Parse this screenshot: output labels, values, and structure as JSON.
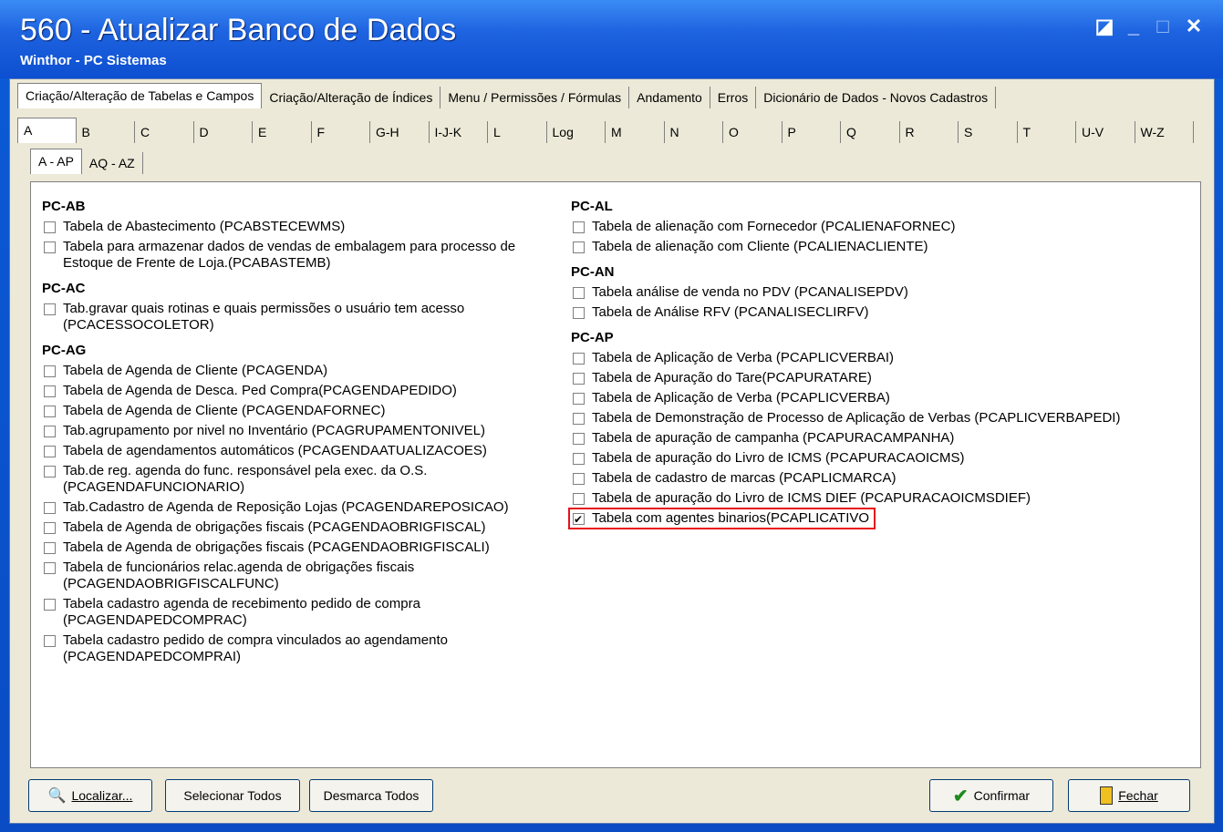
{
  "window": {
    "title": "560 - Atualizar Banco de Dados",
    "subtitle": "Winthor - PC Sistemas",
    "controls": [
      "◪",
      "_",
      "□",
      "✕"
    ]
  },
  "main_tabs": [
    "Criação/Alteração de Tabelas e Campos",
    "Criação/Alteração de Índices",
    "Menu / Permissões / Fórmulas",
    "Andamento",
    "Erros",
    "Dicionário de Dados - Novos Cadastros"
  ],
  "letter_tabs": [
    "A",
    "B",
    "C",
    "D",
    "E",
    "F",
    "G-H",
    "I-J-K",
    "L",
    "Log",
    "M",
    "N",
    "O",
    "P",
    "Q",
    "R",
    "S",
    "T",
    "U-V",
    "W-Z"
  ],
  "sub_tabs": [
    "A - AP",
    "AQ - AZ"
  ],
  "left_groups": [
    {
      "name": "PC-AB",
      "items": [
        {
          "text": "Tabela de Abastecimento (PCABSTECEWMS)",
          "checked": false
        },
        {
          "text": "Tabela para armazenar dados de vendas de embalagem para processo de",
          "text2": "Estoque de Frente de Loja.(PCABASTEMB)",
          "checked": false
        }
      ]
    },
    {
      "name": "PC-AC",
      "items": [
        {
          "text": "Tab.gravar quais rotinas e quais permissões o usuário tem acesso",
          "text2": "(PCACESSOCOLETOR)",
          "checked": false
        }
      ]
    },
    {
      "name": "PC-AG",
      "items": [
        {
          "text": "Tabela  de Agenda de Cliente (PCAGENDA)",
          "checked": false
        },
        {
          "text": "Tabela  de Agenda de Desca. Ped Compra(PCAGENDAPEDIDO)",
          "checked": false
        },
        {
          "text": "Tabela  de Agenda de Cliente (PCAGENDAFORNEC)",
          "checked": false
        },
        {
          "text": "Tab.agrupamento por nivel no Inventário (PCAGRUPAMENTONIVEL)",
          "checked": false
        },
        {
          "text": "Tabela de agendamentos automáticos (PCAGENDAATUALIZACOES)",
          "checked": false
        },
        {
          "text": "Tab.de reg. agenda do func. responsável pela exec. da O.S.",
          "text2": "(PCAGENDAFUNCIONARIO)",
          "checked": false
        },
        {
          "text": "Tab.Cadastro de Agenda de Reposição Lojas (PCAGENDAREPOSICAO)",
          "checked": false
        },
        {
          "text": "Tabela de Agenda de obrigações fiscais (PCAGENDAOBRIGFISCAL)",
          "checked": false
        },
        {
          "text": "Tabela de Agenda de obrigações fiscais (PCAGENDAOBRIGFISCALI)",
          "checked": false
        },
        {
          "text": "Tabela de funcionários relac.agenda de obrigações fiscais",
          "text2": "(PCAGENDAOBRIGFISCALFUNC)",
          "checked": false
        },
        {
          "text": "Tabela cadastro agenda de recebimento pedido de compra",
          "text2": "(PCAGENDAPEDCOMPRAC)",
          "checked": false
        },
        {
          "text": "Tabela cadastro pedido de compra vinculados ao agendamento",
          "text2": "(PCAGENDAPEDCOMPRAI)",
          "checked": false
        }
      ]
    }
  ],
  "right_groups": [
    {
      "name": "PC-AL",
      "items": [
        {
          "text": "Tabela de alienação com Fornecedor (PCALIENAFORNEC)",
          "checked": false
        },
        {
          "text": "Tabela de alienação com Cliente (PCALIENACLIENTE)",
          "checked": false
        }
      ]
    },
    {
      "name": "PC-AN",
      "items": [
        {
          "text": "Tabela análise de venda no PDV (PCANALISEPDV)",
          "checked": false
        },
        {
          "text": "Tabela de Análise RFV (PCANALISECLIRFV)",
          "checked": false
        }
      ]
    },
    {
      "name": "PC-AP",
      "items": [
        {
          "text": "Tabela de Aplicação de Verba (PCAPLICVERBAI)",
          "checked": false
        },
        {
          "text": "Tabela de Apuração do Tare(PCAPURATARE)",
          "checked": false
        },
        {
          "text": "Tabela de Aplicação de Verba (PCAPLICVERBA)",
          "checked": false
        },
        {
          "text": "Tabela de Demonstração de Processo de Aplicação de Verbas (PCAPLICVERBAPEDI)",
          "checked": false
        },
        {
          "text": "Tabela de apuração de campanha (PCAPURACAMPANHA)",
          "checked": false
        },
        {
          "text": "Tabela de apuração do Livro de ICMS (PCAPURACAOICMS)",
          "checked": false
        },
        {
          "text": "Tabela de cadastro de marcas (PCAPLICMARCA)",
          "checked": false
        },
        {
          "text": "Tabela de apuração do Livro de ICMS DIEF (PCAPURACAOICMSDIEF)",
          "checked": false
        },
        {
          "text": "Tabela com agentes binarios(PCAPLICATIVO",
          "checked": true
        }
      ]
    }
  ],
  "buttons": {
    "localizar": "Localizar...",
    "selecionar_todos": "Selecionar Todos",
    "desmarca_todos": "Desmarca Todos",
    "confirmar": "Confirmar",
    "fechar": "Fechar"
  }
}
